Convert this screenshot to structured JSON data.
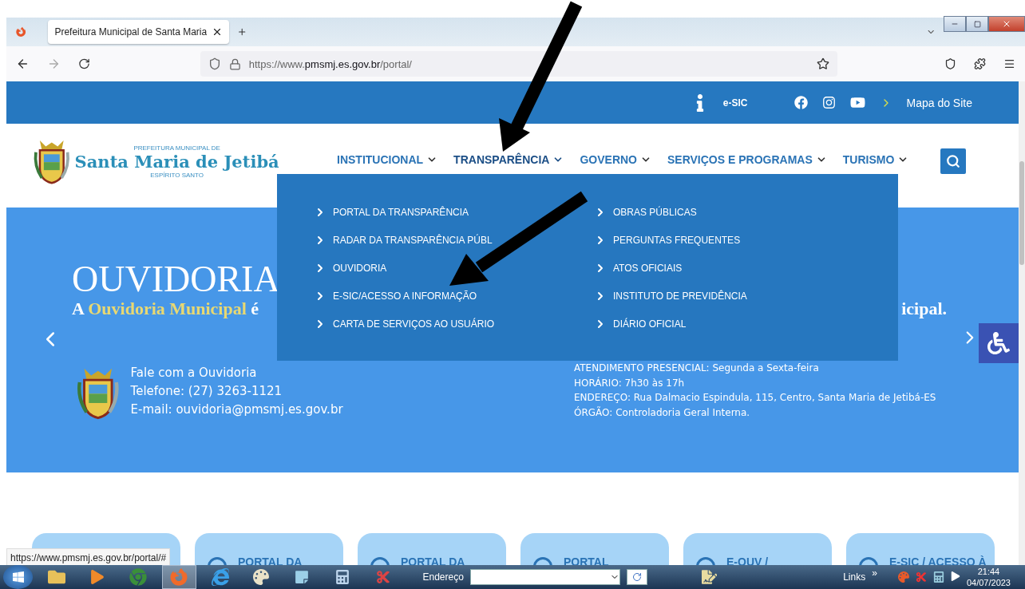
{
  "browser": {
    "tab": {
      "title": "Prefeitura Municipal de Santa Maria",
      "selected": true
    },
    "url": {
      "scheme": "https://www.",
      "host": "pmsmj.es.gov.br",
      "path": "/portal/"
    },
    "status_url": "https://www.pmsmj.es.gov.br/portal/#"
  },
  "topbar": {
    "esic_label": "e-SIC",
    "sitemap_link": "Mapa do Site"
  },
  "header": {
    "logo": {
      "line1": "PREFEITURA MUNICIPAL DE",
      "name": "Santa Maria de Jetibá",
      "line3": "ESPÍRITO SANTO"
    },
    "nav": [
      {
        "label": "INSTITUCIONAL",
        "expanded": false
      },
      {
        "label": "TRANSPARÊNCIA",
        "expanded": true
      },
      {
        "label": "GOVERNO",
        "expanded": false
      },
      {
        "label": "SERVIÇOS E PROGRAMAS",
        "expanded": false
      },
      {
        "label": "TURISMO",
        "expanded": false
      }
    ]
  },
  "dropdown": {
    "columns": [
      [
        "PORTAL DA TRANSPARÊNCIA",
        "RADAR DA TRANSPARÊNCIA PÚBL",
        "OUVIDORIA",
        "E-SIC/ACESSO A INFORMAÇÃO",
        "CARTA DE SERVIÇOS AO USUÁRIO"
      ],
      [
        "OBRAS PÚBLICAS",
        "PERGUNTAS FREQUENTES",
        "ATOS OFICIAIS",
        "INSTITUTO DE PREVIDÊNCIA",
        "DIÁRIO OFICIAL"
      ]
    ]
  },
  "hero": {
    "title": "OUVIDORIA",
    "subtitle": {
      "start": "A",
      "highlight": "Ouvidoria Municipal",
      "end": "é"
    },
    "subtitle_tail": "icipal.",
    "contact": [
      "Fale com a Ouvidoria",
      "Telefone: (27) 3263-1121",
      "E-mail: ouvidoria@pmsmj.es.gov.br"
    ],
    "info": [
      "ATENDIMENTO PRESENCIAL: Segunda a Sexta-feira",
      "HORÁRIO: 7h30 às 17h",
      "ENDEREÇO: Rua Dalmacio Espindula, 115, Centro, Santa Maria de Jetibá-ES",
      "ÓRGÃO: Controladoria Geral Interna."
    ]
  },
  "cards": [
    {
      "kind": "blank"
    },
    {
      "kind": "titled",
      "title": "PORTAL DA"
    },
    {
      "kind": "titled",
      "title": "PORTAL DA"
    },
    {
      "kind": "titled",
      "title": "PORTAL"
    },
    {
      "kind": "titled",
      "title": "E-OUV /"
    },
    {
      "kind": "titled",
      "title": "E-SIC / ACESSO À"
    }
  ],
  "taskbar": {
    "apps": [
      {
        "kind": "folder",
        "selected": false
      },
      {
        "kind": "media",
        "selected": false
      },
      {
        "kind": "chrome",
        "selected": false
      },
      {
        "kind": "firefox",
        "selected": true
      },
      {
        "kind": "ie",
        "selected": false
      },
      {
        "kind": "paint",
        "selected": false
      },
      {
        "kind": "notepad",
        "selected": false
      },
      {
        "kind": "calculator",
        "selected": false
      },
      {
        "kind": "snipping",
        "selected": false
      }
    ],
    "address_label": "Endereço",
    "links_label": "Links",
    "links_more": "»",
    "time": "21:44",
    "date": "04/07/2023"
  }
}
